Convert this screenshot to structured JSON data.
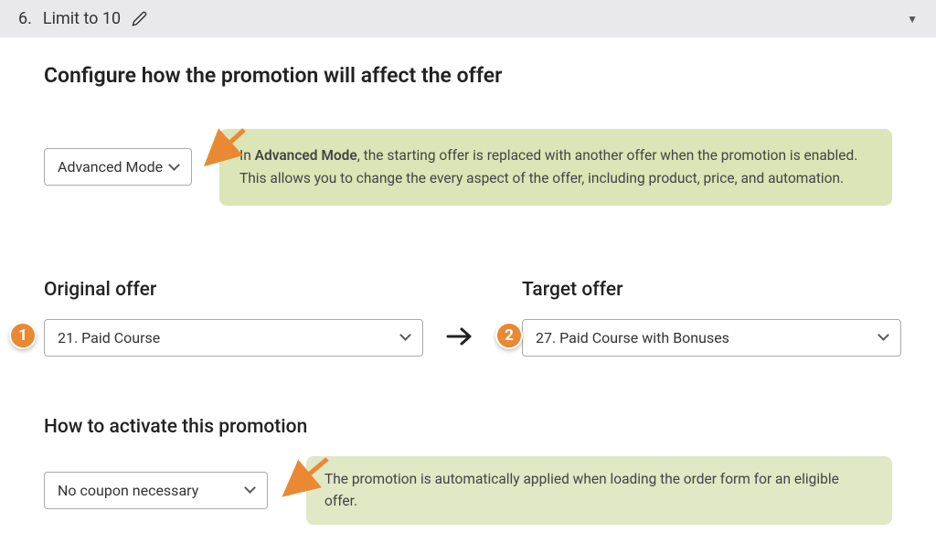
{
  "step": {
    "number": "6.",
    "title": "Limit to 10"
  },
  "section1": {
    "heading": "Configure how the promotion will affect the offer",
    "mode_select": "Advanced Mode",
    "info_bold": "Advanced Mode",
    "info_prefix": "In ",
    "info_suffix": ", the starting offer is replaced with another offer when the promotion is enabled. This allows you to change the every aspect of the offer, including product, price, and automation."
  },
  "offers": {
    "original_label": "Original offer",
    "original_value": "21. Paid Course",
    "target_label": "Target offer",
    "target_value": "27. Paid Course with Bonuses",
    "badge1": "1",
    "badge2": "2"
  },
  "section2": {
    "heading": "How to activate this promotion",
    "select": "No coupon necessary",
    "info": "The promotion is automatically applied when loading the order form for an eligible offer."
  }
}
